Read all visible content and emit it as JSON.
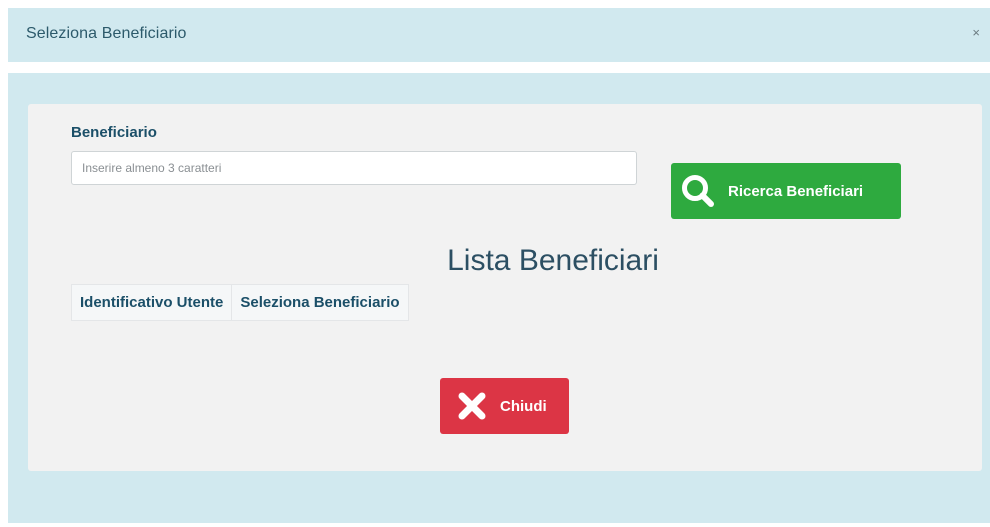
{
  "modal": {
    "title": "Seleziona Beneficiario",
    "close_symbol": "×"
  },
  "form": {
    "label": "Beneficiario",
    "placeholder": "Inserire almeno 3 caratteri",
    "value": "",
    "search_button_label": "Ricerca Beneficiari",
    "search_button_icon": "search-icon"
  },
  "list": {
    "title": "Lista Beneficiari",
    "columns": [
      "Identificativo Utente",
      "Seleziona Beneficiario"
    ],
    "rows": []
  },
  "footer": {
    "close_button_label": "Chiudi",
    "close_button_icon": "x-icon"
  },
  "colors": {
    "header_bg": "#d1e9ef",
    "panel_bg": "#f2f2f2",
    "search_button": "#2eaa3f",
    "close_button": "#dc3545",
    "label_text": "#1b4f68"
  }
}
